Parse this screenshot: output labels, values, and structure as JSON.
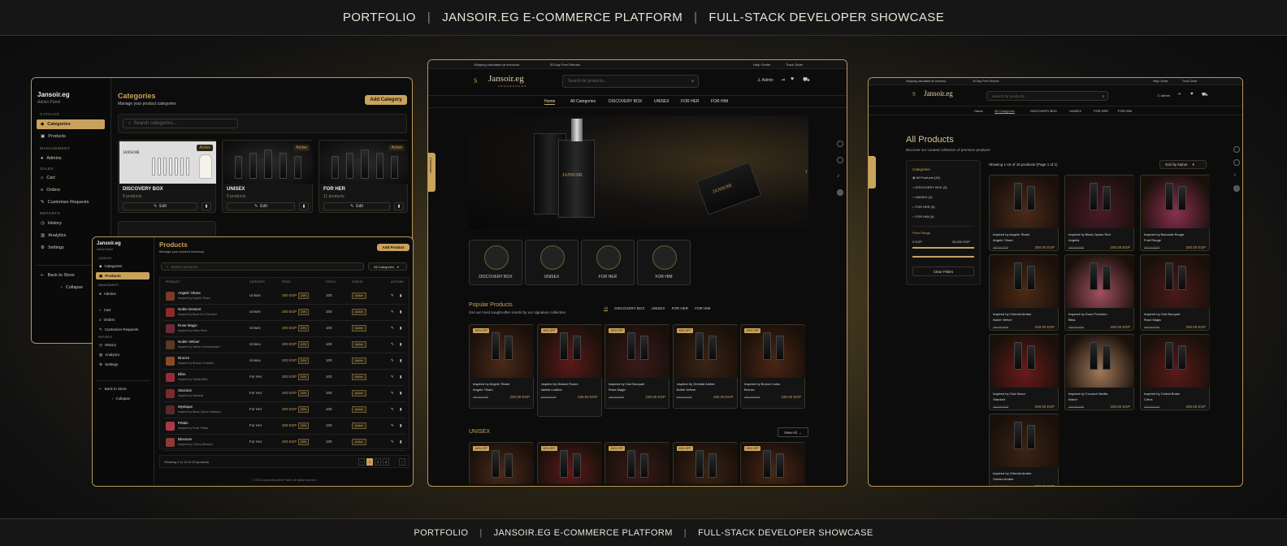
{
  "header": {
    "parts": [
      "PORTFOLIO",
      "JANSOIR.EG E-COMMERCE PLATFORM",
      "FULL-STACK DEVELOPER SHOWCASE"
    ]
  },
  "footer": {
    "parts": [
      "PORTFOLIO",
      "JANSOIR.EG E-COMMERCE PLATFORM",
      "FULL-STACK DEVELOPER SHOWCASE"
    ]
  },
  "admin_categories": {
    "brand": "Jansoir.eg",
    "brand_sub": "Admin Panel",
    "sections": {
      "catalog": "CATALOG",
      "management": "MANAGEMENT",
      "sales": "SALES",
      "reports": "REPORTS"
    },
    "items": {
      "categories": "Categories",
      "products": "Products",
      "admins": "Admins",
      "cart": "Cart",
      "orders": "Orders",
      "requests": "Customize Requests",
      "history": "History",
      "analytics": "Analytics",
      "settings": "Settings",
      "back": "Back to Store",
      "collapse": "Collapse"
    },
    "title": "Categories",
    "subtitle": "Manage your product categories",
    "add_button": "Add Category",
    "search_placeholder": "Search categories...",
    "cards": [
      {
        "name": "DISCOVERY BOX",
        "count": "9 products",
        "badge": "Active",
        "edit": "Edit"
      },
      {
        "name": "UNISEX",
        "count": "5 products",
        "badge": "Active",
        "edit": "Edit"
      },
      {
        "name": "FOR HER",
        "count": "11 products",
        "badge": "Active",
        "edit": "Edit"
      }
    ]
  },
  "admin_products": {
    "brand": "Jansoir.eg",
    "brand_sub": "Admin Panel",
    "sections": {
      "catalog": "CATALOG",
      "management": "MANAGEMENT",
      "reports": "REPORTS"
    },
    "items": {
      "categories": "Categories",
      "products": "Products",
      "admins": "Admins",
      "cart": "Cart",
      "orders": "Orders",
      "requests": "Customize Requests",
      "history": "History",
      "analytics": "Analytics",
      "settings": "Settings",
      "back": "Back to Store",
      "collapse": "Collapse"
    },
    "title": "Products",
    "subtitle": "Manage your product inventory",
    "add_button": "Add Product",
    "search_placeholder": "Search products...",
    "filter": "All Categories",
    "columns": [
      "PRODUCT",
      "CATEGORY",
      "PRICE",
      "STOCK",
      "STATUS",
      "ACTIONS"
    ],
    "rows": [
      {
        "name": "Angels' Share",
        "desc": "Inspired by Angels' Share",
        "cat": "Unisex",
        "price": "200 EGP",
        "tag": "20%",
        "stock": "100",
        "status": "Active",
        "color": "#7a3a2a"
      },
      {
        "name": "Noble Dessert",
        "desc": "Inspired by Bond No.9 Dessert",
        "cat": "Unisex",
        "price": "200 EGP",
        "tag": "20%",
        "stock": "100",
        "status": "Active",
        "color": "#8a2a2a"
      },
      {
        "name": "Rose Magic",
        "desc": "Inspired by Kilian Rose",
        "cat": "Unisex",
        "price": "200 EGP",
        "tag": "20%",
        "stock": "100",
        "status": "Active",
        "color": "#6a2a3a"
      },
      {
        "name": "Noble Vetiver",
        "desc": "Inspired by Vetiver Extraordinaire",
        "cat": "Unisex",
        "price": "200 EGP",
        "tag": "20%",
        "stock": "100",
        "status": "Active",
        "color": "#5a3a22"
      },
      {
        "name": "Bronze",
        "desc": "Inspired by Bronze Goddess",
        "cat": "Unisex",
        "price": "200 EGP",
        "tag": "20%",
        "stock": "100",
        "status": "Active",
        "color": "#8a4a22"
      },
      {
        "name": "Bliss",
        "desc": "Inspired by Vanilla Bliss",
        "cat": "For Her",
        "price": "200 EGP",
        "tag": "20%",
        "stock": "100",
        "status": "Active",
        "color": "#9a2a3a"
      },
      {
        "name": "Stardust",
        "desc": "Inspired by Stardust",
        "cat": "For Her",
        "price": "200 EGP",
        "tag": "20%",
        "stock": "100",
        "status": "Active",
        "color": "#7a2a2a"
      },
      {
        "name": "Mystique",
        "desc": "Inspired by Black Opium Mystique",
        "cat": "For Her",
        "price": "200 EGP",
        "tag": "20%",
        "stock": "100",
        "status": "Active",
        "color": "#5a2a2a"
      },
      {
        "name": "Petals",
        "desc": "Inspired by Rose Petals",
        "cat": "For Her",
        "price": "200 EGP",
        "tag": "20%",
        "stock": "100",
        "status": "Active",
        "color": "#aa3a4a"
      },
      {
        "name": "Blossom",
        "desc": "Inspired by Cherry Blossom",
        "cat": "For Her",
        "price": "200 EGP",
        "tag": "20%",
        "stock": "100",
        "status": "Active",
        "color": "#8a3a3a"
      }
    ],
    "showing": "Showing 1 to 10 of 23 products",
    "pages": [
      "1",
      "2",
      "3"
    ],
    "copyright": "© 2025 Jansoir.eg Admin Panel. All rights reserved."
  },
  "storefront": {
    "topbar_left": [
      "Shipping calculated at checkout",
      "30 Day Free Returns"
    ],
    "topbar_right": [
      "Help Center",
      "Track Order"
    ],
    "brand": "Jansoir.eg",
    "brand_sub": "FRAGRANCES",
    "search_placeholder": "Search for products...",
    "account": "Admin",
    "nav": [
      "Home",
      "All Categories",
      "DISCOVERY BOX",
      "UNISEX",
      "FOR HER",
      "FOR HIM"
    ],
    "side_tab": "Customize",
    "hero_brand": "JANSOIR",
    "categories": [
      "DISCOVERY BOX",
      "UNISEX",
      "FOR HER",
      "FOR HIM"
    ],
    "popular_title": "Popular Products",
    "popular_sub": "Get our most sought-after scents by our signature collection",
    "filters": [
      "All",
      "DISCOVERY BOX",
      "UNISEX",
      "FOR HER",
      "FOR HIM"
    ],
    "products": [
      {
        "name": "Inspired by Angels' Share",
        "sub": "Angels' Share",
        "old": "400.00 EGP",
        "price": "200.00 EGP",
        "badge": "-50% OFF",
        "bg": "#4a2a1a"
      },
      {
        "name": "Inspired by Maison Roses",
        "sub": "Vanilla Leather",
        "old": "400.00 EGP",
        "price": "230.00 EGP",
        "badge": "-50% OFF",
        "bg": "#5a1a1a"
      },
      {
        "name": "Inspired by Oud Bouquet",
        "sub": "Rose Magic",
        "old": "400.00 EGP",
        "price": "230.00 EGP",
        "badge": "-50% OFF",
        "bg": "#3a1a1a"
      },
      {
        "name": "Inspired by Oriental Amber",
        "sub": "Noble Vetiver",
        "old": "400.00 EGP",
        "price": "200.00 EGP",
        "badge": "-50% OFF",
        "bg": "#3a2414"
      },
      {
        "name": "Inspired by Bronze Lotus",
        "sub": "Bronze",
        "old": "400.00 EGP",
        "price": "230.00 EGP",
        "badge": "-50% OFF",
        "bg": "#4a2614"
      }
    ],
    "unisex_title": "UNISEX",
    "view_all": "View All"
  },
  "allproducts": {
    "topbar_left": [
      "Shipping calculated at checkout",
      "30 Day Free Returns"
    ],
    "topbar_right": [
      "Help Center",
      "Track Order"
    ],
    "brand": "Jansoir.eg",
    "search_placeholder": "Search for products...",
    "account": "Admin",
    "nav": [
      "Home",
      "All Categories",
      "DISCOVERY BOX",
      "UNISEX",
      "FOR HER",
      "FOR HIM"
    ],
    "title": "All Products",
    "subtitle": "Discover our curated collection of premium products",
    "filter_head": "Categories",
    "filter_items": [
      "All Products (16)",
      "DISCOVERY BOX (3)",
      "UNISEX (4)",
      "FOR HER (5)",
      "FOR HIM (4)"
    ],
    "price_head": "Price Range",
    "price_min": "0 EGP",
    "price_max": "30,000 EGP",
    "clear": "Clear Filters",
    "showing": "Showing 1-16 of 16 products (Page 1 of 1)",
    "sort": "Sort by Name",
    "grid": [
      {
        "name": "Inspired by Angels' Share",
        "sub": "Angels' Share",
        "old": "400.00 EGP",
        "price": "200.00 EGP",
        "bg": "#4a2a1a"
      },
      {
        "name": "Inspired by Black Opium Red",
        "sub": "Angelia",
        "old": "400.00 EGP",
        "price": "200.00 EGP",
        "bg": "#4a1a2a"
      },
      {
        "name": "Inspired by Baccarat Rouge",
        "sub": "Fruit Rouge",
        "old": "400.00 EGP",
        "price": "200.00 EGP",
        "bg": "#8a3050"
      },
      {
        "name": "Inspired by Oriental Amber",
        "sub": "Noble Vetiver",
        "old": "400.00 EGP",
        "price": "220.00 EGP",
        "bg": "#4a2a14"
      },
      {
        "name": "Inspired by Good Freedom",
        "sub": "Bliss",
        "old": "400.00 EGP",
        "price": "200.00 EGP",
        "bg": "#a05060"
      },
      {
        "name": "Inspired by Oud Bouquet",
        "sub": "Rose Magic",
        "old": "400.00 EGP",
        "price": "200.00 EGP",
        "bg": "#4a1a1a"
      },
      {
        "name": "Inspired by Oud Wood",
        "sub": "Stardust",
        "old": "400.00 EGP",
        "price": "200.00 EGP",
        "bg": "#6a1a1a"
      },
      {
        "name": "Inspired by Coconut Vanilla",
        "sub": "Island",
        "old": "400.00 EGP",
        "price": "200.00 EGP",
        "bg": "#a0785a"
      },
      {
        "name": "Inspired by Cedrat Boise",
        "sub": "Citrus",
        "old": "400.00 EGP",
        "price": "200.00 EGP",
        "bg": "#5a1a1a"
      },
      {
        "name": "Inspired by Oriental Amber",
        "sub": "Golden Amber",
        "old": "400.00 EGP",
        "price": "200.00 EGP",
        "bg": "#3a2414"
      }
    ]
  },
  "colors": {
    "gold": "#c9a35c",
    "bg": "#0c0c0c",
    "border": "#b99654"
  }
}
